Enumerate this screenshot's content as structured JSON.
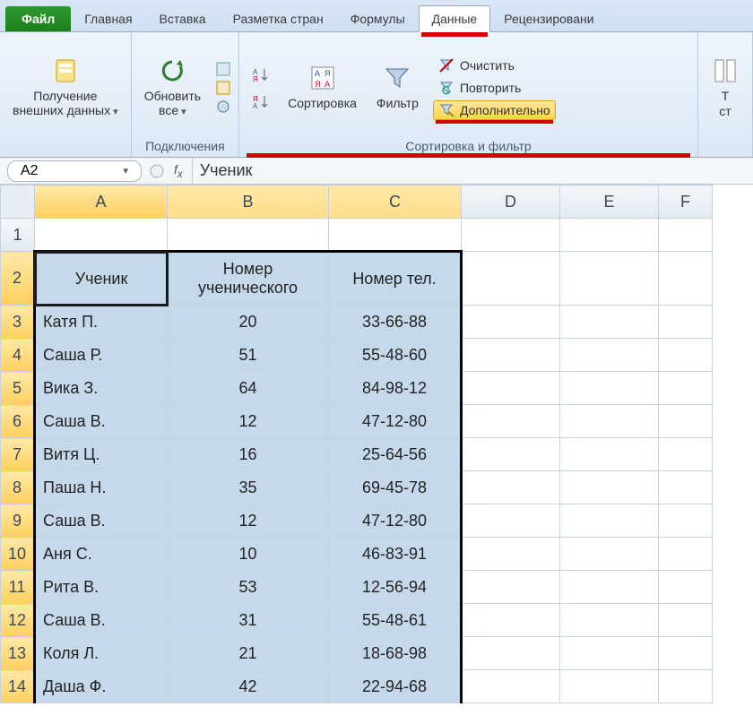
{
  "tabs": {
    "file": "Файл",
    "home": "Главная",
    "insert": "Вставка",
    "layout": "Разметка стран",
    "formulas": "Формулы",
    "data": "Данные",
    "review": "Рецензировани"
  },
  "ribbon": {
    "external": {
      "label": "Получение\nвнешних данных"
    },
    "refresh": {
      "label": "Обновить\nвсе",
      "group": "Подключения"
    },
    "sortaz_icon": "А↓Я",
    "sortza_icon": "Я↓А",
    "sort": "Сортировка",
    "filter": "Фильтр",
    "clear": "Очистить",
    "reapply": "Повторить",
    "advanced": "Дополнительно",
    "sortfilter_group": "Сортировка и фильтр",
    "text_cols": "Т\nст"
  },
  "namebox": "A2",
  "formula_value": "Ученик",
  "columns": [
    "A",
    "B",
    "C",
    "D",
    "E",
    "F"
  ],
  "headers": {
    "a": "Ученик",
    "b": "Номер\nученического",
    "c": "Номер тел."
  },
  "rows": [
    {
      "n": 3,
      "a": "Катя П.",
      "b": 20,
      "c": "33-66-88"
    },
    {
      "n": 4,
      "a": "Саша Р.",
      "b": 51,
      "c": "55-48-60"
    },
    {
      "n": 5,
      "a": "Вика З.",
      "b": 64,
      "c": "84-98-12"
    },
    {
      "n": 6,
      "a": "Саша В.",
      "b": 12,
      "c": "47-12-80"
    },
    {
      "n": 7,
      "a": "Витя Ц.",
      "b": 16,
      "c": "25-64-56"
    },
    {
      "n": 8,
      "a": "Паша Н.",
      "b": 35,
      "c": "69-45-78"
    },
    {
      "n": 9,
      "a": "Саша В.",
      "b": 12,
      "c": "47-12-80"
    },
    {
      "n": 10,
      "a": "Аня С.",
      "b": 10,
      "c": "46-83-91"
    },
    {
      "n": 11,
      "a": "Рита В.",
      "b": 53,
      "c": "12-56-94"
    },
    {
      "n": 12,
      "a": "Саша В.",
      "b": 31,
      "c": "55-48-61"
    },
    {
      "n": 13,
      "a": "Коля Л.",
      "b": 21,
      "c": "18-68-98"
    },
    {
      "n": 14,
      "a": "Даша Ф.",
      "b": 42,
      "c": "22-94-68"
    }
  ]
}
